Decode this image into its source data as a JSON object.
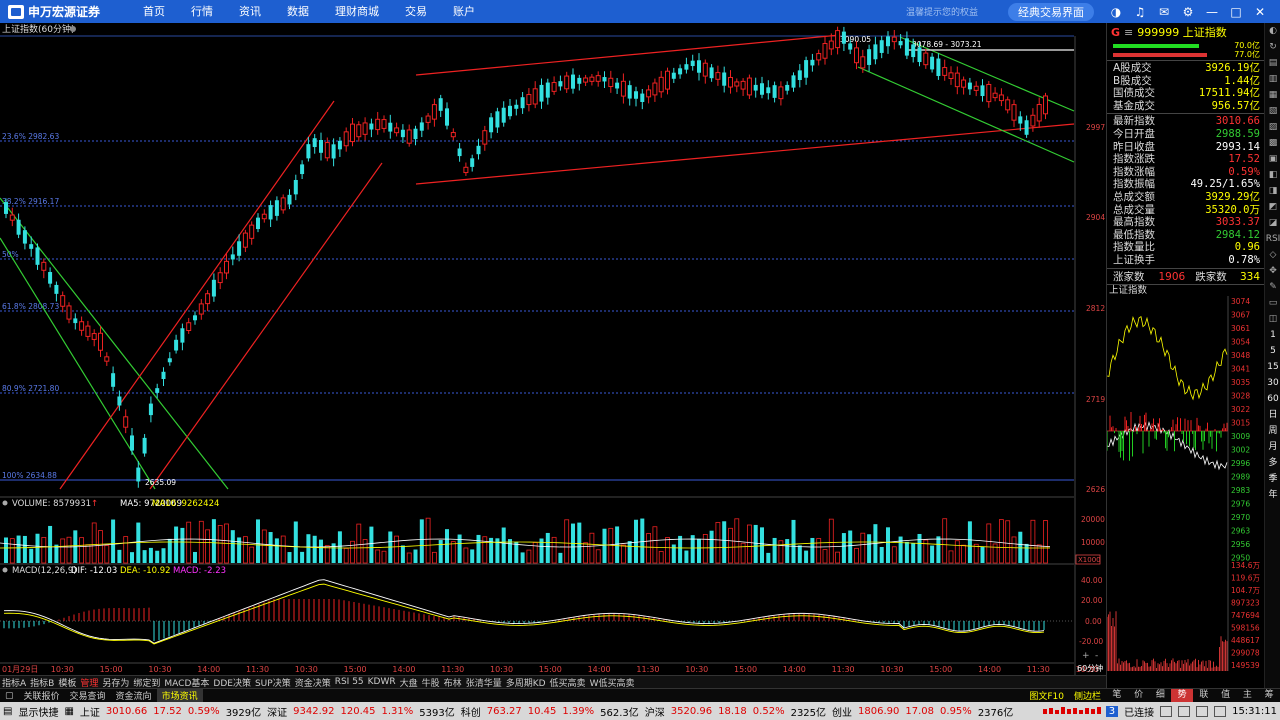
{
  "app": {
    "logo_text": "申万宏源证券"
  },
  "menu": [
    "首页",
    "行情",
    "资讯",
    "数据",
    "理财商城",
    "交易",
    "账户"
  ],
  "top_right": {
    "tip": "温馨提示您的权益",
    "classic_label": "经典交易界面"
  },
  "chart_title": "上证指数(60分钟)",
  "fib_labels": [
    "23.6% 2982.63",
    "38.2% 2916.17",
    "50%",
    "61.8% 2808.73",
    "80.9% 2721.80",
    "100% 2634.88"
  ],
  "price_annotations": {
    "high": "3090.05",
    "range": "3078.69 - 3073.21",
    "low": "2635.09"
  },
  "axis_labels": [
    "2997",
    "2904",
    "2812",
    "2719",
    "2626"
  ],
  "volume_header": {
    "volume": "VOLUME: 8579931",
    "ma5": "MA5: 9720069",
    "ma10": "MA10: 9262424"
  },
  "volume_axis": [
    "20000",
    "10000",
    "X1000"
  ],
  "macd_header": {
    "name": "MACD(12,26,9)",
    "dif": "DIF: -12.03",
    "dea": "DEA: -10.92",
    "macd": "MACD: -2.23"
  },
  "macd_axis": [
    "40.00",
    "20.00",
    "0.00",
    "-20.00"
  ],
  "time_axis": [
    "01月29日",
    "10:30",
    "15:00",
    "10:30",
    "14:00",
    "11:30",
    "10:30",
    "15:00",
    "14:00",
    "11:30",
    "10:30",
    "15:00",
    "14:00",
    "11:30",
    "10:30",
    "15:00",
    "14:00",
    "11:30",
    "10:30",
    "15:00",
    "14:00",
    "11:30",
    "10:30"
  ],
  "period_label": "60分钟",
  "right_panel": {
    "head_g": "G",
    "head_title": "999999 上证指数",
    "ratios": [
      {
        "value": "70.0亿",
        "color": "#2d2"
      },
      {
        "value": "77.0亿",
        "color": "#d33"
      }
    ],
    "stats_a": [
      {
        "label": "A股成交",
        "value": "3926.19亿",
        "color": "#ff0"
      },
      {
        "label": "B股成交",
        "value": "1.44亿",
        "color": "#ff0"
      },
      {
        "label": "国债成交",
        "value": "17511.94亿",
        "color": "#ff0"
      },
      {
        "label": "基金成交",
        "value": "956.57亿",
        "color": "#ff0"
      }
    ],
    "stats_b": [
      {
        "label": "最新指数",
        "value": "3010.66",
        "color": "#f33"
      },
      {
        "label": "今日开盘",
        "value": "2988.59",
        "color": "#3c3"
      },
      {
        "label": "昨日收盘",
        "value": "2993.14",
        "color": "#fff"
      },
      {
        "label": "指数涨跌",
        "value": "17.52",
        "color": "#f33"
      },
      {
        "label": "指数涨幅",
        "value": "0.59%",
        "color": "#f33"
      },
      {
        "label": "指数振幅",
        "value": "49.25/1.65%",
        "color": "#fff"
      },
      {
        "label": "总成交额",
        "value": "3929.29亿",
        "color": "#ff0"
      },
      {
        "label": "总成交量",
        "value": "35320.0万",
        "color": "#ff0"
      },
      {
        "label": "最高指数",
        "value": "3033.37",
        "color": "#f33"
      },
      {
        "label": "最低指数",
        "value": "2984.12",
        "color": "#3c3"
      },
      {
        "label": "指数量比",
        "value": "0.96",
        "color": "#ff0"
      },
      {
        "label": "上证换手",
        "value": "0.78%",
        "color": "#fff"
      }
    ],
    "updown": {
      "up_label": "涨家数",
      "up": "1906",
      "down_label": "跌家数",
      "down": "334"
    },
    "mini_title": "上证指数",
    "mini_axis": [
      "3074",
      "3067",
      "3061",
      "3054",
      "3048",
      "3041",
      "3035",
      "3028",
      "3022",
      "3015",
      "3009",
      "3002",
      "2996",
      "2989",
      "2983",
      "2976",
      "2970",
      "2963",
      "2956",
      "2950"
    ],
    "mini_vol_axis": [
      "134.6万",
      "119.6万",
      "104.7万",
      "897323",
      "747694",
      "598156",
      "448617",
      "299078",
      "149539"
    ]
  },
  "right_strip": [
    "◐",
    "↻",
    "▤",
    "▥",
    "▦",
    "▧",
    "▨",
    "▩",
    "▣",
    "◧",
    "◨",
    "◩",
    "◪",
    "RSI",
    "◇",
    "✥",
    "✎",
    "▭",
    "◫",
    "1",
    "5",
    "15",
    "30",
    "60",
    "日",
    "周",
    "月",
    "多",
    "季",
    "年"
  ],
  "tabs1": [
    "指标A",
    "指标B",
    "模板",
    "管理",
    "另存为",
    "绑定到",
    "MACD基本",
    "DDE决策",
    "SUP决策",
    "资金决策",
    "RSI 55",
    "KDWR",
    "大盘",
    "牛股",
    "布林",
    "张清华量",
    "多周期KD",
    "低买高卖",
    "W低买高卖"
  ],
  "tabs1_active": "管理",
  "tabs2": [
    "关联报价",
    "交易查询",
    "资金流向",
    "市场资讯"
  ],
  "tabs2_right": [
    "图文F10",
    "侧边栏"
  ],
  "rtabs": [
    "笔",
    "价",
    "细",
    "势",
    "联",
    "值",
    "主",
    "筹"
  ],
  "rtabs_active": "势",
  "status": {
    "show_quick": "显示快捷",
    "sh_label": "上证",
    "sh_val": "3010.66",
    "sh_chg": "17.52",
    "sh_pct": "0.59%",
    "sh_amt": "3929亿",
    "sz_label": "深证",
    "sz_val": "9342.92",
    "sz_chg": "120.45",
    "sz_pct": "1.31%",
    "sz_amt": "5393亿",
    "kc_label": "科创",
    "kc_val": "763.27",
    "kc_chg": "10.45",
    "kc_pct": "1.39%",
    "kc_amt": "562.3亿",
    "hs_label": "沪深",
    "hs_val": "3520.96",
    "hs_chg": "18.18",
    "hs_pct": "0.52%",
    "hs_amt": "2325亿",
    "cy_label": "创业",
    "cy_val": "1806.90",
    "cy_chg": "17.08",
    "cy_pct": "0.95%",
    "cy_amt": "2376亿",
    "conn_num": "3",
    "conn_text": "已连接",
    "time": "15:31:11"
  }
}
